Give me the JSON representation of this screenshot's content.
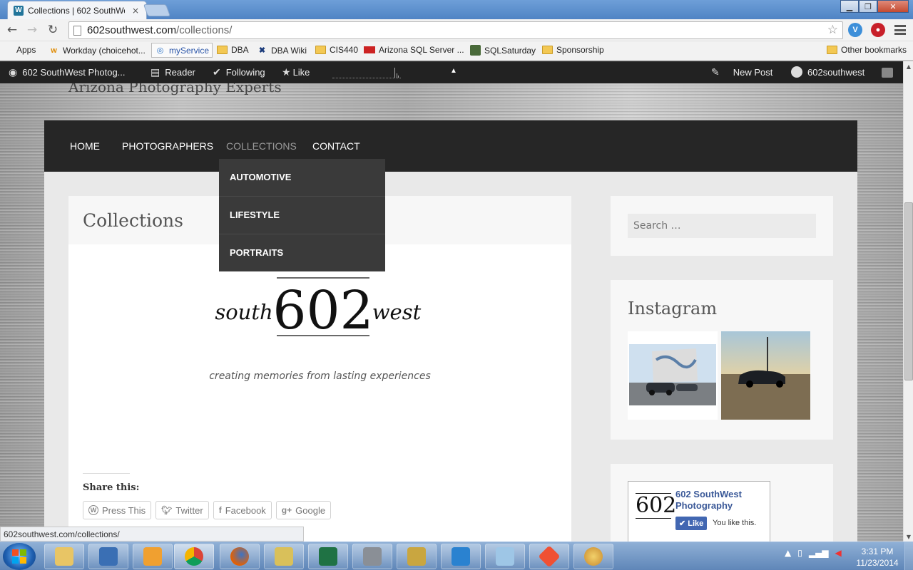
{
  "browser": {
    "tab_title": "Collections | 602 SouthWe",
    "tab_close": "×",
    "url_domain": "602southwest.com",
    "url_path": "/collections/",
    "window_min": "▁",
    "window_max": "❐",
    "window_close": "✕"
  },
  "bookmarks": {
    "items": [
      {
        "label": "Apps",
        "icon": "apps-grid-icon"
      },
      {
        "label": "Workday (choicehot...",
        "icon": "workday-icon"
      },
      {
        "label": "myService",
        "icon": "myservice-icon"
      },
      {
        "label": "DBA",
        "icon": "folder-icon"
      },
      {
        "label": "DBA Wiki",
        "icon": "wiki-icon"
      },
      {
        "label": "CIS440",
        "icon": "folder-icon"
      },
      {
        "label": "Arizona SQL Server ...",
        "icon": "site-icon"
      },
      {
        "label": "SQLSaturday",
        "icon": "site-icon"
      },
      {
        "label": "Sponsorship",
        "icon": "folder-icon"
      }
    ],
    "other": "Other bookmarks"
  },
  "adminbar": {
    "site": "602 SouthWest Photog...",
    "reader": "Reader",
    "following": "Following",
    "like": "Like",
    "new_post": "New Post",
    "user": "602southwest"
  },
  "site": {
    "tagline": "Arizona Photography Experts",
    "nav": [
      "Home",
      "Photographers",
      "Collections",
      "Contact"
    ],
    "dropdown": [
      "Automotive",
      "Lifestyle",
      "Portraits"
    ]
  },
  "content": {
    "title": "Collections",
    "logo_left": "south",
    "logo_num": "602",
    "logo_right": "west",
    "motto": "creating memories from lasting experiences",
    "share_title": "Share this:",
    "share_buttons": [
      {
        "label": "Press This",
        "icon": "W"
      },
      {
        "label": "Twitter",
        "icon": "t"
      },
      {
        "label": "Facebook",
        "icon": "f"
      },
      {
        "label": "Google",
        "icon": "g+"
      }
    ]
  },
  "sidebar": {
    "search_placeholder": "Search …",
    "instagram_title": "Instagram",
    "fb_name_line1": "602 SouthWest",
    "fb_name_line2": "Photography",
    "fb_like": "Like",
    "fb_you": "You like this.",
    "fb_logo": "602"
  },
  "status": {
    "url": "602southwest.com/collections/"
  },
  "taskbar": {
    "time": "3:31 PM",
    "date": "11/23/2014"
  },
  "colors": {
    "nav_bg": "#262626",
    "dropdown_bg": "#3a3a3a",
    "admin_bg": "#222222",
    "fb_blue": "#3b5998"
  }
}
